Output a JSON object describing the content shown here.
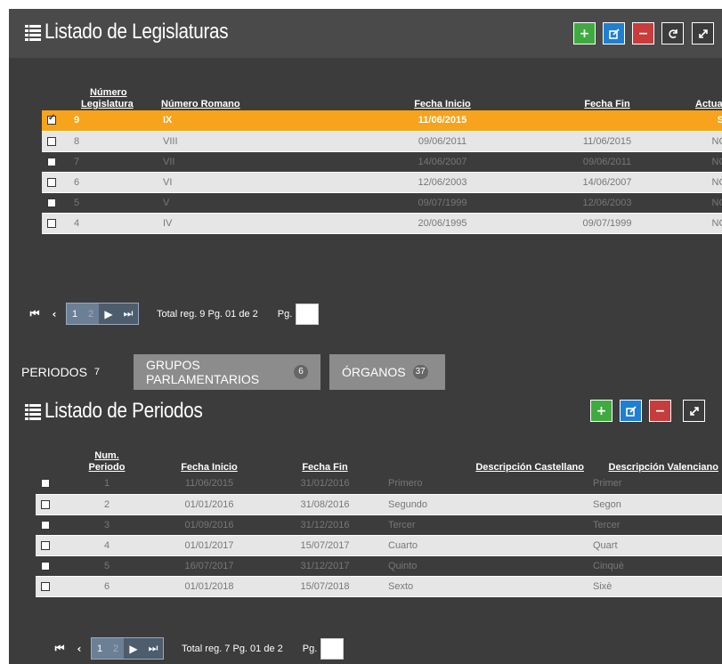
{
  "legislaturas": {
    "title": "Listado de Legislaturas",
    "columns": [
      "Número Legislatura",
      "Número Romano",
      "Fecha Inicio",
      "Fecha Fin",
      "Actual?"
    ],
    "col_numero_l1": "Número",
    "col_numero_l2": "Legislatura",
    "rows": [
      {
        "numero": "9",
        "romano": "IX",
        "inicio": "11/06/2015",
        "fin": "",
        "actual": "SI",
        "selected": true
      },
      {
        "numero": "8",
        "romano": "VIII",
        "inicio": "09/06/2011",
        "fin": "11/06/2015",
        "actual": "NO"
      },
      {
        "numero": "7",
        "romano": "VII",
        "inicio": "14/06/2007",
        "fin": "09/06/2011",
        "actual": "NO"
      },
      {
        "numero": "6",
        "romano": "VI",
        "inicio": "12/06/2003",
        "fin": "14/06/2007",
        "actual": "NO"
      },
      {
        "numero": "5",
        "romano": "V",
        "inicio": "09/07/1999",
        "fin": "12/06/2003",
        "actual": "NO"
      },
      {
        "numero": "4",
        "romano": "IV",
        "inicio": "20/06/1995",
        "fin": "09/07/1999",
        "actual": "NO"
      }
    ],
    "pager": {
      "page1": "1",
      "page2": "2",
      "total": "Total reg. 9 Pg. 01 de 2",
      "pg_label": "Pg."
    }
  },
  "tabs": [
    {
      "label": "PERIODOS",
      "count": "7"
    },
    {
      "label": "GRUPOS PARLAMENTARIOS",
      "count": "6"
    },
    {
      "label": "ÓRGANOS",
      "count": "37"
    }
  ],
  "periodos": {
    "title": "Listado de Periodos",
    "col_num_l1": "Num.",
    "col_num_l2": "Periodo",
    "columns": [
      "Num. Periodo",
      "Fecha Inicio",
      "Fecha Fin",
      "Descripción Castellano",
      "Descripción Valenciano"
    ],
    "rows": [
      {
        "num": "1",
        "inicio": "11/06/2015",
        "fin": "31/01/2016",
        "cast": "Primero",
        "val": "Primer"
      },
      {
        "num": "2",
        "inicio": "01/01/2016",
        "fin": "31/08/2016",
        "cast": "Segundo",
        "val": "Segon"
      },
      {
        "num": "3",
        "inicio": "01/09/2016",
        "fin": "31/12/2016",
        "cast": "Tercer",
        "val": "Tercer"
      },
      {
        "num": "4",
        "inicio": "01/01/2017",
        "fin": "15/07/2017",
        "cast": "Cuarto",
        "val": "Quart"
      },
      {
        "num": "5",
        "inicio": "16/07/2017",
        "fin": "31/12/2017",
        "cast": "Quinto",
        "val": "Cinquè"
      },
      {
        "num": "6",
        "inicio": "01/01/2018",
        "fin": "15/07/2018",
        "cast": "Sexto",
        "val": "Sixè"
      }
    ],
    "pager": {
      "page1": "1",
      "page2": "2",
      "total": "Total reg. 7 Pg. 01 de 2",
      "pg_label": "Pg."
    }
  },
  "icons": {
    "add": "plus-icon",
    "edit": "edit-icon",
    "remove": "minus-icon",
    "refresh": "refresh-icon",
    "expand": "expand-icon",
    "first": "first-page-icon",
    "prev": "prev-page-icon",
    "next": "next-page-icon",
    "last": "last-page-icon"
  },
  "colors": {
    "selected_row": "#f7a31c",
    "panel": "#3c3c3c",
    "add": "#3faa3f",
    "edit": "#1f7fd0",
    "remove": "#c83c3c"
  }
}
